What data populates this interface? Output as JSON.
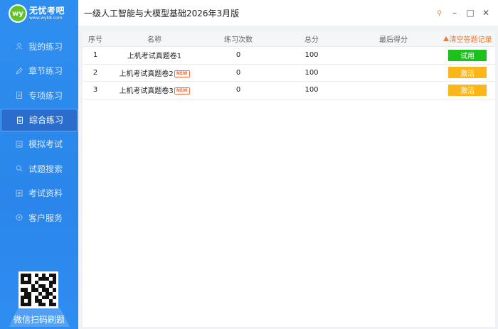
{
  "app": {
    "logo_badge": "wy",
    "logo_title": "无忧考吧",
    "logo_url": "www.wyk8.com",
    "title": "一级人工智能与大模型基础2026年3月版"
  },
  "window_controls": {
    "pin_icon": "pin-icon",
    "minimize_label": "–",
    "maximize_label": "□",
    "close_label": "✕"
  },
  "sidebar": {
    "items": [
      {
        "label": "我的练习",
        "icon": "user-icon",
        "active": false
      },
      {
        "label": "章节练习",
        "icon": "pencil-icon",
        "active": false
      },
      {
        "label": "专项练习",
        "icon": "document-icon",
        "active": false
      },
      {
        "label": "综合练习",
        "icon": "clipboard-icon",
        "active": true
      },
      {
        "label": "模拟考试",
        "icon": "exam-icon",
        "active": false
      },
      {
        "label": "试题搜索",
        "icon": "search-icon",
        "active": false
      },
      {
        "label": "考试资料",
        "icon": "folder-icon",
        "active": false
      },
      {
        "label": "客户服务",
        "icon": "service-icon",
        "active": false
      }
    ],
    "qr_caption": "微信扫码刷题"
  },
  "table": {
    "headers": {
      "idx": "序号",
      "name": "名称",
      "count": "练习次数",
      "score": "总分",
      "last": "最后得分",
      "clear": "清空答题记录"
    },
    "rows": [
      {
        "idx": "1",
        "name": "上机考试真题卷1",
        "is_new": false,
        "count": "0",
        "score": "100",
        "last": "",
        "action": "试用",
        "action_color": "#1dc11d"
      },
      {
        "idx": "2",
        "name": "上机考试真题卷2",
        "is_new": true,
        "count": "0",
        "score": "100",
        "last": "",
        "action": "激活",
        "action_color": "#fbb619"
      },
      {
        "idx": "3",
        "name": "上机考试真题卷3",
        "is_new": true,
        "count": "0",
        "score": "100",
        "last": "",
        "action": "激活",
        "action_color": "#fbb619"
      }
    ],
    "new_tag": "NEW"
  },
  "colors": {
    "sidebar": "#2e8ef0",
    "active_nav": "#2a6dcc",
    "trial_button": "#1dc11d",
    "activate_button": "#fbb619",
    "clear_link": "#f0762c"
  }
}
